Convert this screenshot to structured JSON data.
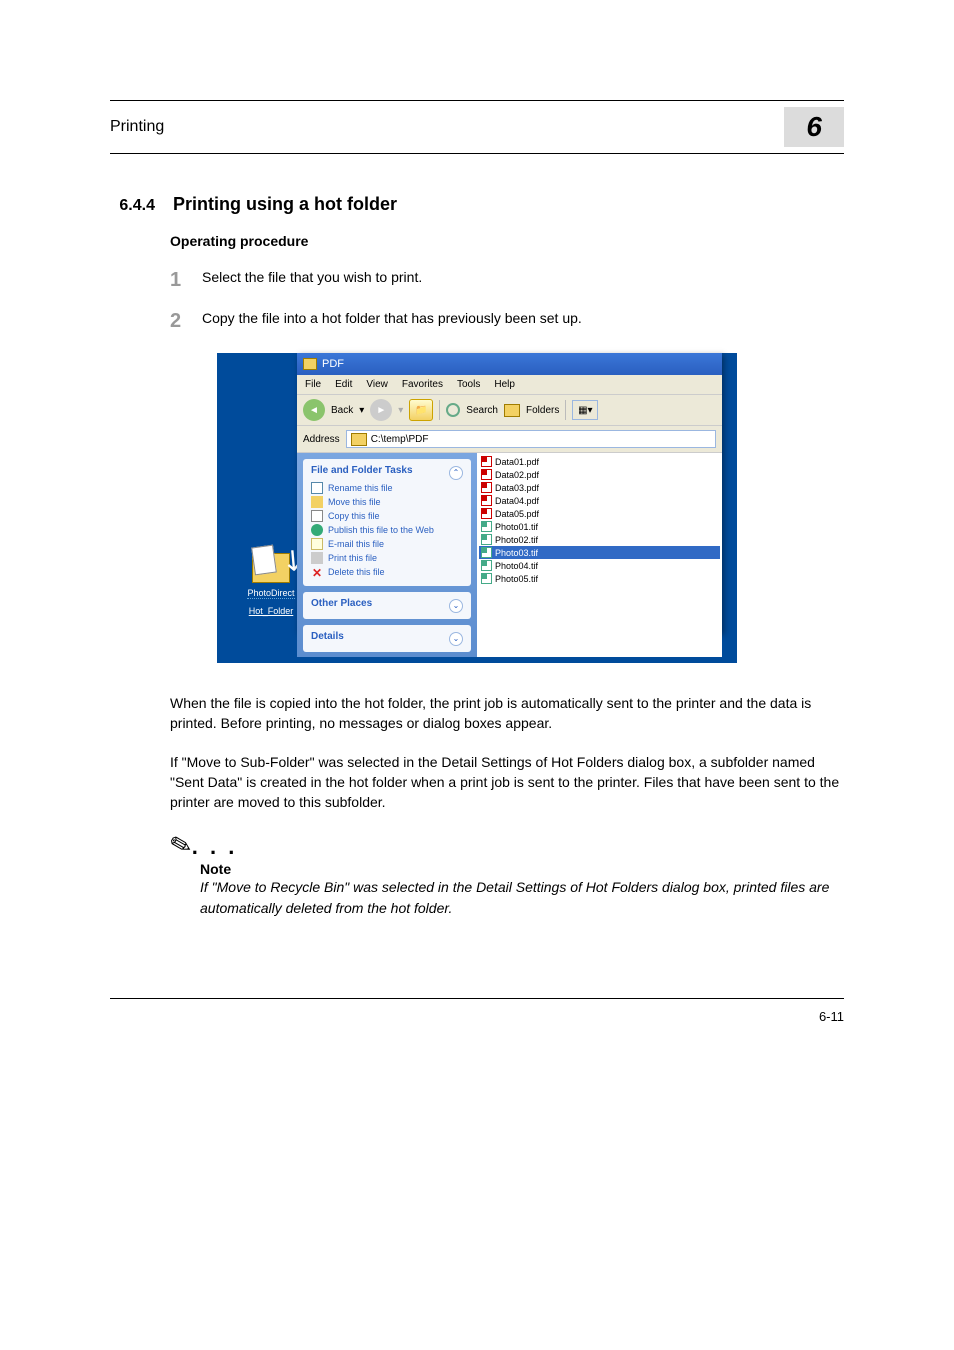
{
  "header": {
    "left": "Printing",
    "chapter_number": "6"
  },
  "section": {
    "number": "6.4.4",
    "title": "Printing using a hot folder"
  },
  "subheading": "Operating procedure",
  "steps": [
    {
      "num": "1",
      "text": "Select the file that you wish to print."
    },
    {
      "num": "2",
      "text": "Copy the file into a hot folder that has previously been set up."
    }
  ],
  "explorer": {
    "title": "PDF",
    "menu": [
      "File",
      "Edit",
      "View",
      "Favorites",
      "Tools",
      "Help"
    ],
    "toolbar": {
      "back": "Back",
      "search": "Search",
      "folders": "Folders"
    },
    "address_label": "Address",
    "address_value": "C:\\temp\\PDF",
    "tasks_panel": {
      "title": "File and Folder Tasks",
      "items": [
        "Rename this file",
        "Move this file",
        "Copy this file",
        "Publish this file to the Web",
        "E-mail this file",
        "Print this file",
        "Delete this file"
      ]
    },
    "other_panel": "Other Places",
    "details_panel": "Details",
    "files": [
      {
        "name": "Data01.pdf",
        "type": "pdf",
        "sel": false
      },
      {
        "name": "Data02.pdf",
        "type": "pdf",
        "sel": false
      },
      {
        "name": "Data03.pdf",
        "type": "pdf",
        "sel": false
      },
      {
        "name": "Data04.pdf",
        "type": "pdf",
        "sel": false
      },
      {
        "name": "Data05.pdf",
        "type": "pdf",
        "sel": false
      },
      {
        "name": "Photo01.tif",
        "type": "tif",
        "sel": false
      },
      {
        "name": "Photo02.tif",
        "type": "tif",
        "sel": false
      },
      {
        "name": "Photo03.tif",
        "type": "tif",
        "sel": true
      },
      {
        "name": "Photo04.tif",
        "type": "tif",
        "sel": false
      },
      {
        "name": "Photo05.tif",
        "type": "tif",
        "sel": false
      }
    ]
  },
  "hot_folder": {
    "line1": "PhotoDirect",
    "line2": "Hot_Folder"
  },
  "paragraphs": [
    "When the file is copied into the hot folder, the print job is automatically sent to the printer and the data is printed. Before printing, no messages or dialog boxes appear.",
    "If \"Move to Sub-Folder\" was selected in the Detail Settings of Hot Folders dialog box, a subfolder named \"Sent Data\" is created in the hot folder when a print job is sent to the printer. Files that have been sent to the printer are moved to this subfolder."
  ],
  "note": {
    "label": "Note",
    "text": "If \"Move to Recycle Bin\" was selected in the Detail Settings of Hot Folders dialog box, printed files are automatically deleted from the hot folder."
  },
  "footer": {
    "page": "6-11"
  }
}
